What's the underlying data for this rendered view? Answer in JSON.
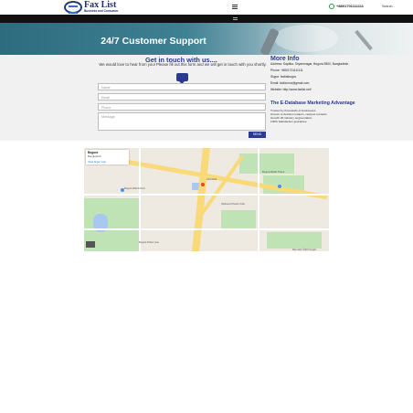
{
  "header": {
    "logo_name": "Fax List",
    "logo_tagline": "Business and Consumer",
    "phone": "+8801701111111",
    "search_label": "Search..."
  },
  "hero": {
    "title": "24/7 Customer Support"
  },
  "contact": {
    "heading": "Get in touch with us....",
    "intro": "We would love to hear from you! Please fill out this form and we will get in touch with you shortly.",
    "fields": [
      {
        "placeholder": "Name"
      },
      {
        "placeholder": "Email"
      },
      {
        "placeholder": "Phone"
      },
      {
        "placeholder": "Message"
      }
    ],
    "send_label": "SEND"
  },
  "more_info": {
    "title": "More Info",
    "address": "Address: Saptika, Shyamnagar, Bogura 5800, Bangladesh.",
    "phone": "Phone: +8801701111111",
    "skype": "Skype: faxlistbogra",
    "email": "Email: faxlist.ma@gmail.com",
    "website": "Website: http://www.faxlist.net/"
  },
  "advantage": {
    "title": "The E-Database Marketing Advantage",
    "bullets": [
      "Trusted by thousands of businesses",
      "Access to decision makers, campus contacts",
      "Growth 20 industry segmentation",
      "100% Satisfaction guarantee"
    ]
  },
  "map": {
    "place_name": "Bogura",
    "place_sub": "Bangladesh",
    "link": "View larger map",
    "labels": [
      "Bogura Zilla School",
      "Satmatha",
      "Shaheed Khokon Park",
      "Bogura Model Thana",
      "Bogura Police Line"
    ],
    "credit": "Map data ©2023 Google",
    "colors": {
      "park": "#bfe3b5",
      "water": "#a9c8ef",
      "major_road": "#f9d978",
      "land": "#eeeae2"
    }
  }
}
